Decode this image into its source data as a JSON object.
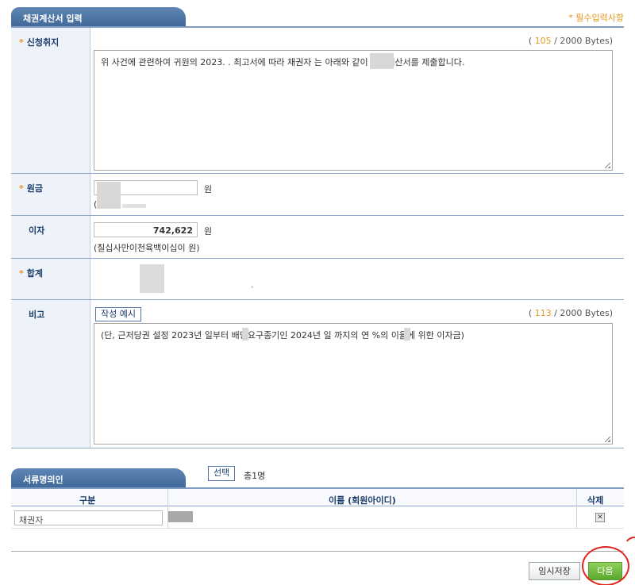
{
  "section1": {
    "title": "채권계산서 입력",
    "required_note": "* 필수입력사항"
  },
  "purpose": {
    "label": "신청취지",
    "bytes_open": "(",
    "bytes_count": "105",
    "bytes_rest": "/ 2000 Bytes)",
    "text": "위 사건에 관련하여 귀원의 2023.        . 최고서에 따라 채권자        는 아래와 같이 채권계산서를 제출합니다."
  },
  "principal": {
    "label": "원금",
    "value": "",
    "unit": "원",
    "korean": "("
  },
  "interest": {
    "label": "이자",
    "value": "742,622",
    "unit": "원",
    "korean": "(칠십사만이천육백이십이 원)"
  },
  "total": {
    "label": "합계",
    "mark": ","
  },
  "remarks": {
    "label": "비고",
    "example_button": "작성 예시",
    "bytes_open": "(",
    "bytes_count": "113",
    "bytes_rest": "/ 2000 Bytes)",
    "text": "(단, 근저당권 설정 2023년        일부터 배당요구종기인 2024년          일 까지의 연      %의 이율에 위한 이자금)"
  },
  "section2": {
    "title": "서류명의인",
    "select_button": "선택",
    "count": "총1명"
  },
  "signers": {
    "columns": [
      "구분",
      "이름 (회원아이디)",
      "삭제"
    ],
    "rows": [
      {
        "type": "채권자",
        "name": ""
      }
    ]
  },
  "footer": {
    "save_button": "임시저장",
    "next_button": "다음"
  },
  "colors": {
    "accent": "#e6981f",
    "header": "#3f6898",
    "next": "#5aa82e",
    "annotation": "#e0261e"
  }
}
